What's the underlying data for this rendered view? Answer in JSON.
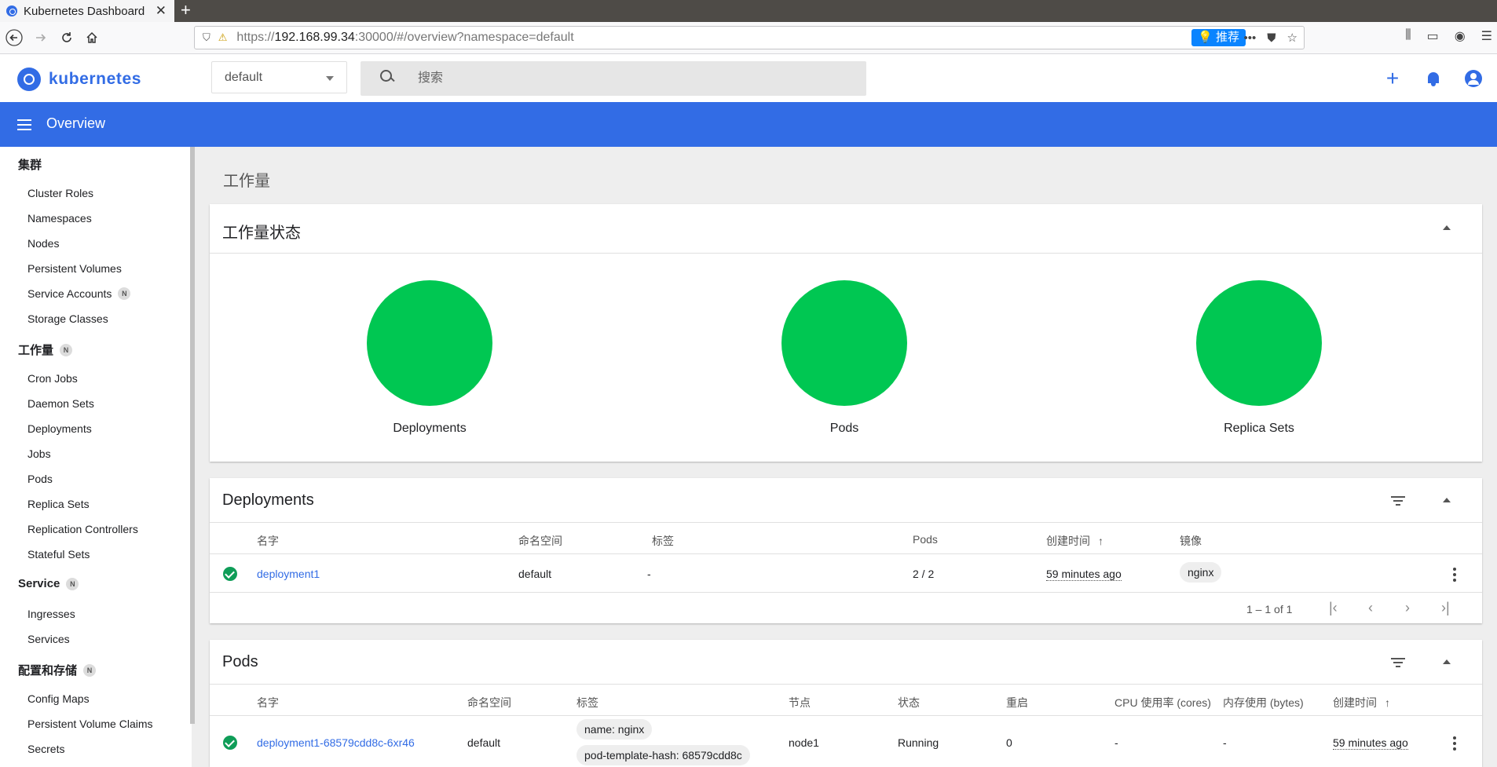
{
  "browser": {
    "tab_title": "Kubernetes Dashboard",
    "tab_close": "✕",
    "new_tab": "+",
    "url_prefix": "https://",
    "url_host": "192.168.99.34",
    "url_rest": ":30000/#/overview?namespace=default",
    "recommend_label": "推荐"
  },
  "app": {
    "brand": "kubernetes",
    "namespace_value": "default",
    "search_placeholder": "搜索",
    "add_label": "+"
  },
  "header": {
    "title": "Overview"
  },
  "sidebar": {
    "sections": [
      {
        "title": "集群",
        "badge": "",
        "items": [
          "Cluster Roles",
          "Namespaces",
          "Nodes",
          "Persistent Volumes",
          "Service Accounts",
          "Storage Classes"
        ],
        "item_badges": {
          "Service Accounts": "N"
        }
      },
      {
        "title": "工作量",
        "badge": "N",
        "items": [
          "Cron Jobs",
          "Daemon Sets",
          "Deployments",
          "Jobs",
          "Pods",
          "Replica Sets",
          "Replication Controllers",
          "Stateful Sets"
        ]
      },
      {
        "title": "Service",
        "badge": "N",
        "items": [
          "Ingresses",
          "Services"
        ]
      },
      {
        "title": "配置和存储",
        "badge": "N",
        "items": [
          "Config Maps",
          "Persistent Volume Claims",
          "Secrets"
        ]
      }
    ],
    "service_accounts_badge": "N"
  },
  "main": {
    "section_title": "工作量",
    "workload_status": {
      "title": "工作量状态",
      "items": [
        {
          "label": "Deployments",
          "color": "#00c752"
        },
        {
          "label": "Pods",
          "color": "#00c752"
        },
        {
          "label": "Replica Sets",
          "color": "#00c752"
        }
      ]
    },
    "deployments": {
      "title": "Deployments",
      "columns": [
        "名字",
        "命名空间",
        "标签",
        "Pods",
        "创建时间",
        "镜像"
      ],
      "sort_indicator": "↑",
      "rows": [
        {
          "name": "deployment1",
          "namespace": "default",
          "labels": "-",
          "pods": "2 / 2",
          "created": "59 minutes ago",
          "image": "nginx"
        }
      ],
      "pagination": "1 – 1 of 1"
    },
    "pods": {
      "title": "Pods",
      "columns": [
        "名字",
        "命名空间",
        "标签",
        "节点",
        "状态",
        "重启",
        "CPU 使用率 (cores)",
        "内存使用 (bytes)",
        "创建时间"
      ],
      "sort_indicator": "↑",
      "rows": [
        {
          "name": "deployment1-68579cdd8c-6xr46",
          "namespace": "default",
          "labels": [
            "name: nginx",
            "pod-template-hash: 68579cdd8c"
          ],
          "node": "node1",
          "status": "Running",
          "restarts": "0",
          "cpu": "-",
          "memory": "-",
          "created": "59 minutes ago"
        }
      ]
    }
  },
  "icons": {
    "back": "back-arrow-icon",
    "forward": "forward-arrow-icon",
    "reload": "reload-icon",
    "home": "home-icon",
    "search": "search-icon",
    "bell": "bell-icon",
    "account": "account-icon",
    "menu": "hamburger-menu-icon",
    "filter": "filter-icon",
    "collapse": "collapse-icon",
    "check": "check-circle-icon",
    "kebab": "more-vert-icon"
  }
}
